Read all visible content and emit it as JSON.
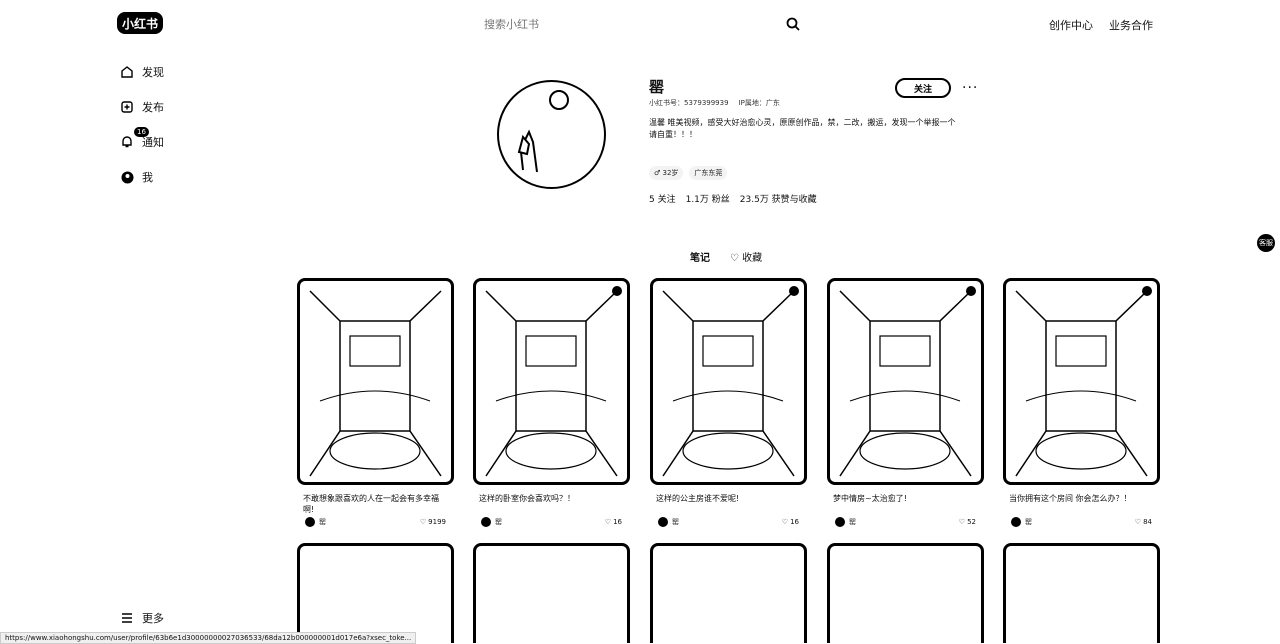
{
  "header": {
    "logo_text": "小红书",
    "search_placeholder": "搜索小红书",
    "nav": [
      "创作中心",
      "业务合作"
    ]
  },
  "sidebar": {
    "items": [
      {
        "label": "发现",
        "icon": "home-icon"
      },
      {
        "label": "发布",
        "icon": "plus-square-icon"
      },
      {
        "label": "通知",
        "icon": "bell-icon",
        "badge": "16"
      },
      {
        "label": "我",
        "icon": "avatar-icon"
      }
    ],
    "more_label": "更多"
  },
  "profile": {
    "name": "罂",
    "red_id": "小红书号：5379399939",
    "ip": "IP属地：广东",
    "bio_line1": "温馨 唯美视频，感受大好治愈心灵，原原创作品，禁，二改，搬运，发现一个举报一个",
    "bio_line2": "请自重！！！",
    "tags": [
      "♂ 32岁",
      "广东东莞"
    ],
    "stats": {
      "following": "5 关注",
      "followers": "1.1万 粉丝",
      "likes": "23.5万 获赞与收藏"
    },
    "follow_label": "关注",
    "more": "···"
  },
  "tabs": {
    "notes": "笔记",
    "collect": "收藏"
  },
  "float_label": "客服",
  "cards": [
    {
      "title": "不敢想象跟喜欢的人在一起会有多幸福啊!",
      "author": "罂",
      "likes": "9199"
    },
    {
      "title": "这样的卧室你会喜欢吗？！",
      "author": "罂",
      "likes": "16"
    },
    {
      "title": "这样的公主房谁不爱呢!",
      "author": "罂",
      "likes": "16"
    },
    {
      "title": "梦中情房~太治愈了!",
      "author": "罂",
      "likes": "52"
    },
    {
      "title": "当你拥有这个房间 你会怎么办？！",
      "author": "罂",
      "likes": "84"
    }
  ],
  "status_url": "https://www.xiaohongshu.com/user/profile/63b6e1d30000000027036533/68da12b000000001d017e6a?xsec_toke..."
}
